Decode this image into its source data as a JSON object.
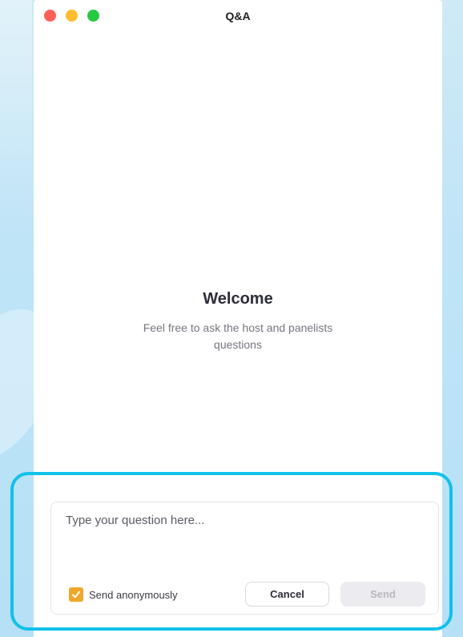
{
  "window": {
    "title": "Q&A",
    "traffic_lights": {
      "close_color": "#fe5f57",
      "minimize_color": "#febc2e",
      "maximize_color": "#28c840"
    }
  },
  "welcome": {
    "title": "Welcome",
    "message": "Feel free to ask the host and panelists questions"
  },
  "composer": {
    "placeholder": "Type your question here...",
    "value": "",
    "anonymous": {
      "label": "Send anonymously",
      "checked": true,
      "checkbox_color": "#f0a82a"
    },
    "cancel_label": "Cancel",
    "send_label": "Send",
    "send_enabled": false
  },
  "highlight_color": "#10c1ea"
}
